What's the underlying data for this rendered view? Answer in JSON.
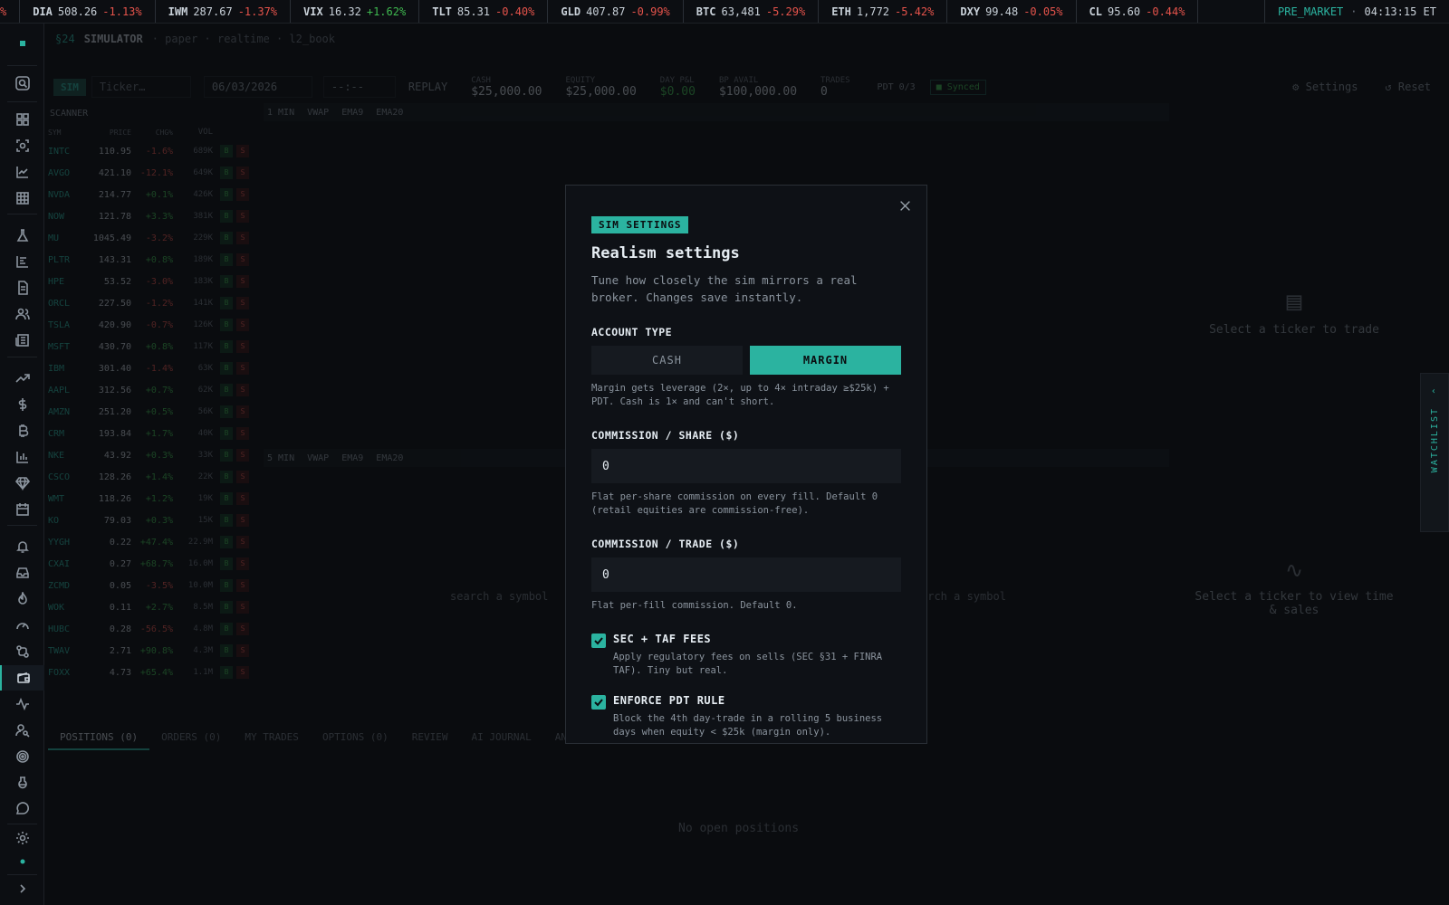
{
  "ticker": [
    {
      "sym": "DIA",
      "price": "508.26",
      "chg": "-1.13%",
      "dir": "neg"
    },
    {
      "sym": "IWM",
      "price": "287.67",
      "chg": "-1.37%",
      "dir": "neg"
    },
    {
      "sym": "VIX",
      "price": "16.32",
      "chg": "+1.62%",
      "dir": "pos"
    },
    {
      "sym": "TLT",
      "price": "85.31",
      "chg": "-0.40%",
      "dir": "neg"
    },
    {
      "sym": "GLD",
      "price": "407.87",
      "chg": "-0.99%",
      "dir": "neg"
    },
    {
      "sym": "BTC",
      "price": "63,481",
      "chg": "-5.29%",
      "dir": "neg"
    },
    {
      "sym": "ETH",
      "price": "1,772",
      "chg": "-5.42%",
      "dir": "neg"
    },
    {
      "sym": "DXY",
      "price": "99.48",
      "chg": "-0.05%",
      "dir": "neg"
    },
    {
      "sym": "CL",
      "price": "95.60",
      "chg": "-0.44%",
      "dir": "neg"
    }
  ],
  "ticker_lead": "%",
  "market_status": "PRE_MARKET",
  "clock": "04:13:15 ET",
  "breadcrumb": {
    "section": "§24",
    "title": "SIMULATOR",
    "meta": "· paper · realtime · l2_book"
  },
  "toolbar": {
    "sim_label": "SIM",
    "ticker_placeholder": "Ticker…",
    "date": "06/03/2026",
    "time": "--:--",
    "replay": "REPLAY",
    "stats": [
      {
        "label": "CASH",
        "value": "$25,000.00"
      },
      {
        "label": "EQUITY",
        "value": "$25,000.00"
      },
      {
        "label": "DAY P&L",
        "value": "$0.00"
      },
      {
        "label": "BP AVAIL",
        "value": "$100,000.00"
      },
      {
        "label": "TRADES",
        "value": "0"
      }
    ],
    "pdt": "PDT 0/3",
    "synced": "■ Synced",
    "settings": "⚙ Settings",
    "reset": "↺ Reset"
  },
  "scanner": {
    "title": "SCANNER",
    "headers": [
      "SYM",
      "PRICE",
      "CHG%",
      "VOL"
    ],
    "rows": [
      [
        "INTC",
        "110.95",
        "-1.6%",
        "689K"
      ],
      [
        "AVGO",
        "421.10",
        "-12.1%",
        "649K"
      ],
      [
        "NVDA",
        "214.77",
        "+0.1%",
        "426K"
      ],
      [
        "NOW",
        "121.78",
        "+3.3%",
        "381K"
      ],
      [
        "MU",
        "1045.49",
        "-3.2%",
        "229K"
      ],
      [
        "PLTR",
        "143.31",
        "+0.8%",
        "189K"
      ],
      [
        "HPE",
        "53.52",
        "-3.0%",
        "183K"
      ],
      [
        "ORCL",
        "227.50",
        "-1.2%",
        "141K"
      ],
      [
        "TSLA",
        "420.90",
        "-0.7%",
        "126K"
      ],
      [
        "MSFT",
        "430.70",
        "+0.8%",
        "117K"
      ],
      [
        "IBM",
        "301.40",
        "-1.4%",
        "63K"
      ],
      [
        "AAPL",
        "312.56",
        "+0.7%",
        "62K"
      ],
      [
        "AMZN",
        "251.20",
        "+0.5%",
        "56K"
      ],
      [
        "CRM",
        "193.84",
        "+1.7%",
        "40K"
      ],
      [
        "NKE",
        "43.92",
        "+0.3%",
        "33K"
      ],
      [
        "CSCO",
        "128.26",
        "+1.4%",
        "22K"
      ],
      [
        "WMT",
        "118.26",
        "+1.2%",
        "19K"
      ],
      [
        "KO",
        "79.03",
        "+0.3%",
        "15K"
      ],
      [
        "YYGH",
        "0.22",
        "+47.4%",
        "22.9M"
      ],
      [
        "CXAI",
        "0.27",
        "+68.7%",
        "16.0M"
      ],
      [
        "ZCMD",
        "0.05",
        "-3.5%",
        "10.0M"
      ],
      [
        "WOK",
        "0.11",
        "+2.7%",
        "8.5M"
      ],
      [
        "HUBC",
        "0.28",
        "-56.5%",
        "4.8M"
      ],
      [
        "TWAV",
        "2.71",
        "+90.8%",
        "4.3M"
      ],
      [
        "FOXX",
        "4.73",
        "+65.4%",
        "1.1M"
      ]
    ],
    "buy": "B",
    "sell": "S"
  },
  "chart1": {
    "tf": "1 MIN",
    "ind": [
      "VWAP",
      "EMA9",
      "EMA20"
    ]
  },
  "chart2": {
    "tf": "5 MIN",
    "ind": [
      "VWAP",
      "EMA9",
      "EMA20"
    ]
  },
  "search_placeholder": "search a symbol",
  "search_placeholder_2": "arch a symbol",
  "right_panel": {
    "trade": "Select a ticker to trade",
    "tape": "Select a ticker to view time & sales"
  },
  "watchlist": "WATCHLIST",
  "bottom_tabs": [
    "POSITIONS (0)",
    "ORDERS (0)",
    "MY TRADES",
    "OPTIONS (0)",
    "REVIEW",
    "AI JOURNAL",
    "AN"
  ],
  "no_positions": "No open positions",
  "modal": {
    "tag": "SIM SETTINGS",
    "title": "Realism settings",
    "subtitle": "Tune how closely the sim mirrors a real broker. Changes save instantly.",
    "account_type_label": "ACCOUNT TYPE",
    "cash": "CASH",
    "margin": "MARGIN",
    "account_help": "Margin gets leverage (2×, up to 4× intraday ≥$25k) + PDT. Cash is 1× and can't short.",
    "comm_share_label": "COMMISSION / SHARE ($)",
    "comm_share_value": "0",
    "comm_share_help": "Flat per-share commission on every fill. Default 0 (retail equities are commission-free).",
    "comm_trade_label": "COMMISSION / TRADE ($)",
    "comm_trade_value": "0",
    "comm_trade_help": "Flat per-fill commission. Default 0.",
    "fees_label": "SEC + TAF FEES",
    "fees_help": "Apply regulatory fees on sells (SEC §31 + FINRA TAF). Tiny but real.",
    "pdt_label": "ENFORCE PDT RULE",
    "pdt_help": "Block the 4th day-trade in a rolling 5 business days when equity < $25k (margin only)."
  },
  "colors": {
    "accent": "#2bb3a0",
    "negative": "#e5534b",
    "positive": "#3fb950"
  }
}
